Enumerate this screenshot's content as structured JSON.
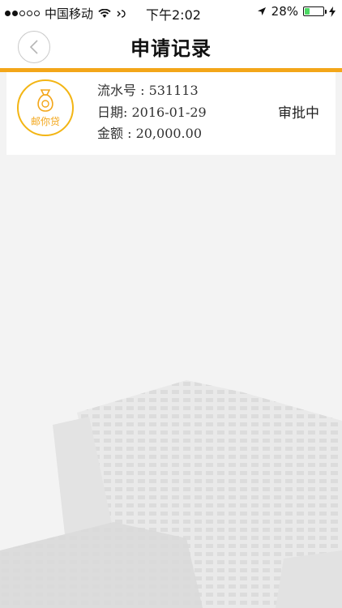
{
  "status_bar": {
    "carrier": "中国移动",
    "time": "下午2:02",
    "battery_percent": "28%",
    "battery_level": 0.28
  },
  "nav": {
    "title": "申请记录",
    "back_icon": "chevron-left-icon"
  },
  "colors": {
    "accent": "#f3a619",
    "logo_gold": "#f3b514",
    "battery_green": "#4cd964"
  },
  "records": [
    {
      "logo_label": "邮你贷",
      "serial": "流水号 : 531113",
      "date": "日期: 2016-01-29",
      "amount": "金额 : 20,000.00",
      "status": "审批中"
    }
  ]
}
